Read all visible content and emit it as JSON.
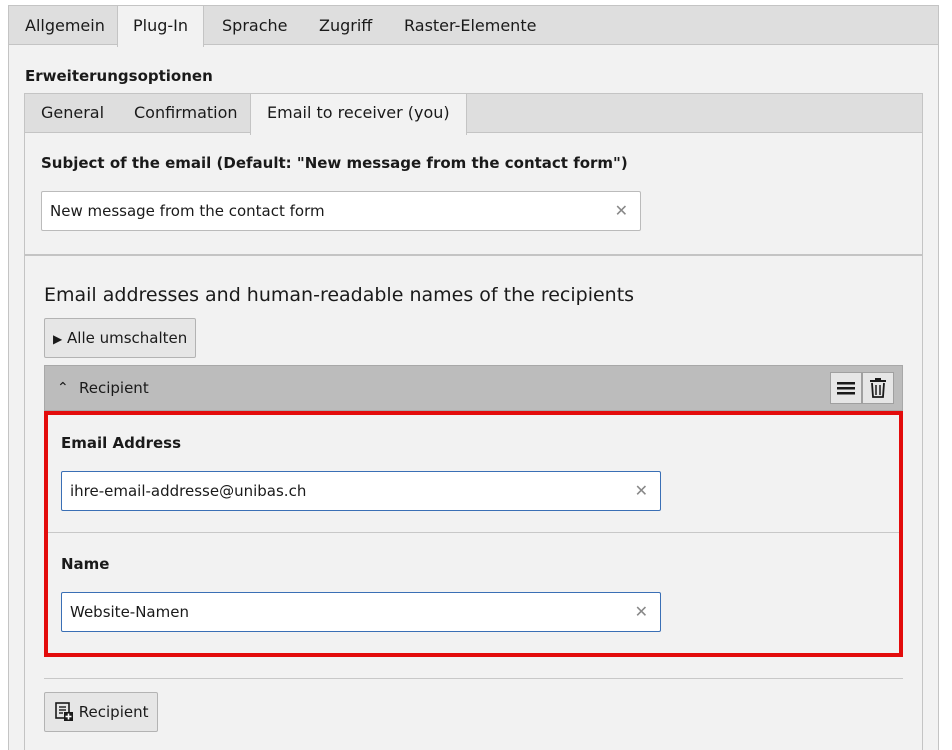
{
  "outer_tabs": [
    "Allgemein",
    "Plug-In",
    "Sprache",
    "Zugriff",
    "Raster-Elemente"
  ],
  "active_outer_tab": "Plug-In",
  "section_title": "Erweiterungsoptionen",
  "inner_tabs": [
    "General",
    "Confirmation",
    "Email to receiver (you)"
  ],
  "active_inner_tab": "Email to receiver (you)",
  "subject": {
    "label": "Subject of the email (Default: \"New message from the contact form\")",
    "value": "New message from the contact form"
  },
  "recipients": {
    "heading": "Email addresses and human-readable names of the recipients",
    "toggle_all_label": "Alle umschalten",
    "item_title": "Recipient",
    "email_label": "Email Address",
    "email_value": "ihre-email-addresse@unibas.ch",
    "name_label": "Name",
    "name_value": "Website-Namen",
    "add_label": "Recipient"
  },
  "highlight_color": "#e30c0c"
}
